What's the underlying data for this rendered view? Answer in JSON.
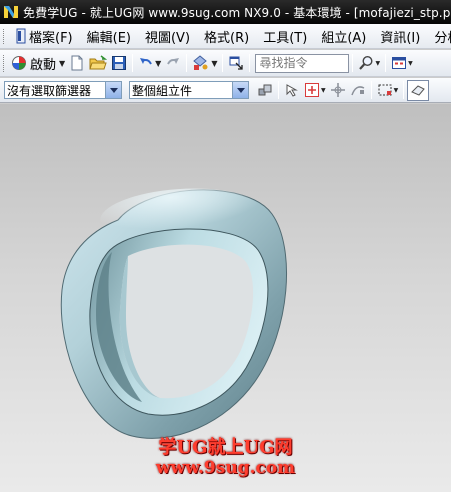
{
  "window": {
    "title": "免費学UG - 就上UG网 www.9sug.com   NX9.0 - 基本環境 - [mofajiezi_stp.prt"
  },
  "menubar": {
    "items": [
      {
        "label": "檔案(F)"
      },
      {
        "label": "編輯(E)"
      },
      {
        "label": "視圖(V)"
      },
      {
        "label": "格式(R)"
      },
      {
        "label": "工具(T)"
      },
      {
        "label": "組立(A)"
      },
      {
        "label": "資訊(I)"
      },
      {
        "label": "分析(L"
      }
    ]
  },
  "toolbar": {
    "start_label": "啟動",
    "search": {
      "placeholder": "尋找指令",
      "value": ""
    }
  },
  "selection_bar": {
    "filter": {
      "value": "沒有選取篩選器"
    },
    "scope": {
      "value": "整個組立件"
    }
  },
  "viewport": {
    "background_top": "#bfbfbf",
    "background_bottom": "#eaeaea",
    "model_color": "#b3d1d9"
  },
  "watermark": {
    "line1": "学UG就上UG网",
    "line2": "www.9sug.com"
  },
  "colors": {
    "titlebar": "#111111",
    "accent": "#3b7bd8",
    "watermark": "#ff3d2e"
  }
}
